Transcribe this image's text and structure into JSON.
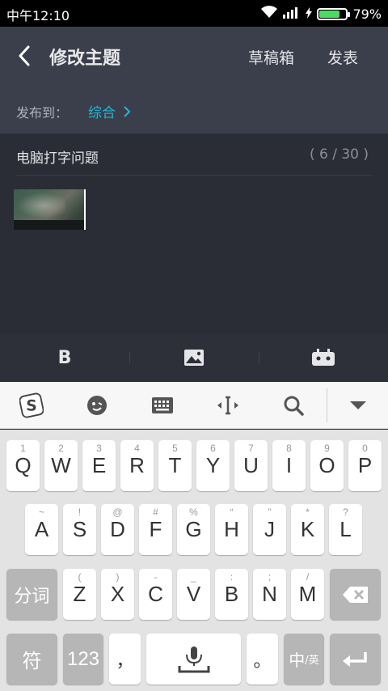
{
  "status_bar": {
    "time": "中午12:10",
    "battery_percent": "79%",
    "battery_level": 0.79,
    "battery_color": "#4cd964"
  },
  "header": {
    "back_icon": "chevron-left-icon",
    "title": "修改主题",
    "drafts_label": "草稿箱",
    "publish_label": "发表",
    "post_to_label": "发布到：",
    "post_to_target": "综合",
    "accent_color": "#1fb8d8"
  },
  "editor": {
    "subject": "电脑打字问题",
    "char_count": "( 6 / 30 )",
    "attachment": "game-screenshot-thumbnail"
  },
  "toolbar": {
    "bold_label": "B",
    "image_icon": "image-icon",
    "emoji_icon": "gamepad-icon"
  },
  "keyboard_bar": {
    "icons": [
      "sogou-logo-icon",
      "emoji-face-icon",
      "keyboard-icon",
      "cursor-move-icon",
      "search-icon",
      "collapse-down-icon"
    ]
  },
  "keyboard": {
    "row1": [
      {
        "label": "Q",
        "hint": "1"
      },
      {
        "label": "W",
        "hint": "2"
      },
      {
        "label": "E",
        "hint": "3"
      },
      {
        "label": "R",
        "hint": "4"
      },
      {
        "label": "T",
        "hint": "5"
      },
      {
        "label": "Y",
        "hint": "6"
      },
      {
        "label": "U",
        "hint": "7"
      },
      {
        "label": "I",
        "hint": "8"
      },
      {
        "label": "O",
        "hint": "9"
      },
      {
        "label": "P",
        "hint": "0"
      }
    ],
    "row2": [
      {
        "label": "A",
        "hint": "~"
      },
      {
        "label": "S",
        "hint": "!"
      },
      {
        "label": "D",
        "hint": "@"
      },
      {
        "label": "F",
        "hint": "#"
      },
      {
        "label": "G",
        "hint": "%"
      },
      {
        "label": "H",
        "hint": "“"
      },
      {
        "label": "J",
        "hint": "”"
      },
      {
        "label": "K",
        "hint": "*"
      },
      {
        "label": "L",
        "hint": "?"
      }
    ],
    "row3": [
      {
        "label": "Z",
        "hint": "("
      },
      {
        "label": "X",
        "hint": ")"
      },
      {
        "label": "C",
        "hint": "-"
      },
      {
        "label": "V",
        "hint": "_"
      },
      {
        "label": "B",
        "hint": ":"
      },
      {
        "label": "N",
        "hint": ";"
      },
      {
        "label": "M",
        "hint": "/"
      }
    ],
    "fenci_label": "分词",
    "symbol_label": "符",
    "num_label": "123",
    "comma_label": "，",
    "period_label": "。",
    "lang_label_main": "中",
    "lang_label_sub": "/英"
  }
}
